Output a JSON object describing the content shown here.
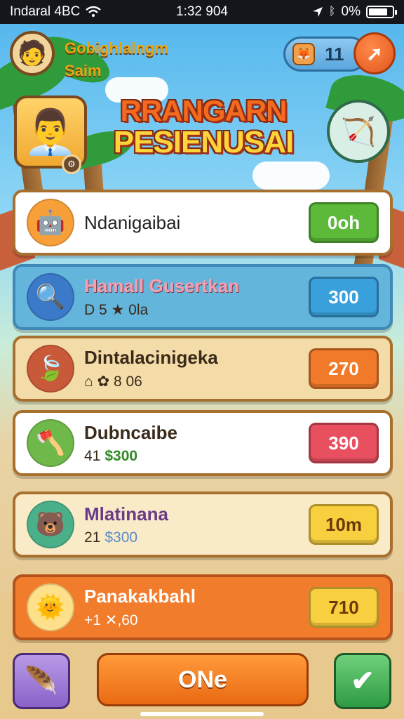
{
  "status_bar": {
    "carrier": "Indaral 4BC",
    "time": "1:32 904",
    "battery_pct": "0%",
    "icons": [
      "wifi-icon",
      "location-icon",
      "bluetooth-icon",
      "battery-icon"
    ]
  },
  "header": {
    "player_name": "Gobighlalngm",
    "player_subtitle": "Saim",
    "coins": "11",
    "title_line1": "RRANGARN",
    "title_line2": "PESIENUSAI"
  },
  "items": [
    {
      "title": "Ndanigaibai",
      "sub": "",
      "sub_price": "",
      "button": "0oh",
      "icon": "robot-icon",
      "button_color": "#5cb93a"
    },
    {
      "title": "Hamall Gusertkan",
      "sub": "D 5 ★ 0la",
      "sub_price": "",
      "button": "300",
      "icon": "magnifier-icon",
      "button_color": "#3aa0dc"
    },
    {
      "title": "Dintalacinigeka",
      "sub": "⌂ ✿ 8 06",
      "sub_price": "",
      "button": "270",
      "icon": "leaf-icon",
      "button_color": "#f07a2a"
    },
    {
      "title": "Dubncaibe",
      "sub": "41",
      "sub_price": "$300",
      "button": "390",
      "icon": "axe-icon",
      "button_color": "#e85060"
    },
    {
      "title": "Mlatinana",
      "sub": "21",
      "sub_price": "$300",
      "button": "10m",
      "icon": "creature-icon",
      "button_color": "#f8cf3e"
    },
    {
      "title": "Panakakbahl",
      "sub": "+1 ✕,60",
      "sub_price": "",
      "button": "710",
      "icon": "sun-icon",
      "button_color": "#f8cf3e"
    }
  ],
  "bottom": {
    "main_label": "ONe",
    "left_icon": "feather-icon",
    "right_icon": "check-icon"
  },
  "colors": {
    "accent_orange": "#f07c2c",
    "sky": "#7cc7ef",
    "frame_brown": "#a8702e"
  }
}
